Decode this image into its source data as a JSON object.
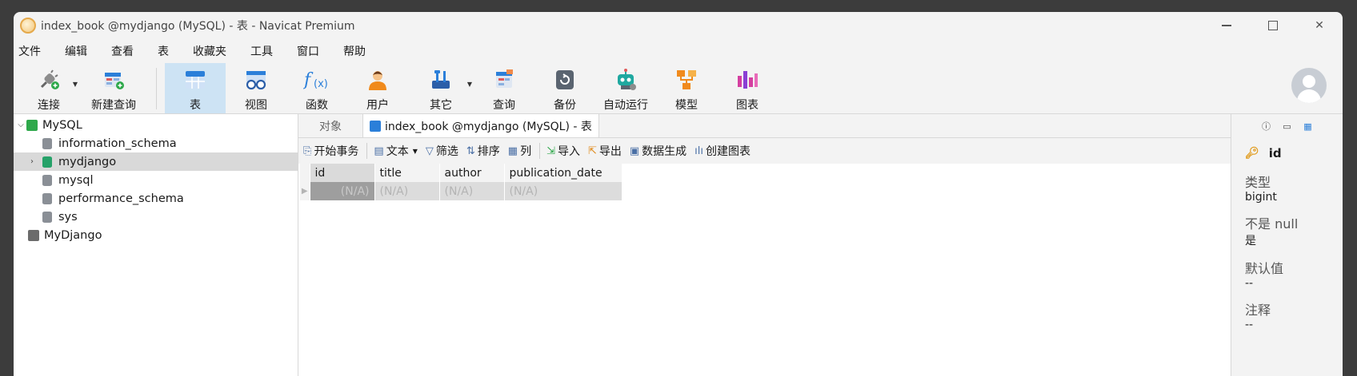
{
  "window": {
    "title": "index_book @mydjango (MySQL) - 表 - Navicat Premium"
  },
  "menu": [
    "文件",
    "编辑",
    "查看",
    "表",
    "收藏夹",
    "工具",
    "窗口",
    "帮助"
  ],
  "toolbar": {
    "connect": "连接",
    "new_query": "新建查询",
    "table": "表",
    "view": "视图",
    "function": "函数",
    "user": "用户",
    "other": "其它",
    "query": "查询",
    "backup": "备份",
    "automation": "自动运行",
    "model": "模型",
    "chart": "图表"
  },
  "nav": {
    "connection": "MySQL",
    "databases": [
      "information_schema",
      "mydjango",
      "mysql",
      "performance_schema",
      "sys"
    ],
    "connection2": "MyDjango"
  },
  "tabs": {
    "objects": "对象",
    "active": "index_book @mydjango (MySQL) - 表"
  },
  "subtoolbar": {
    "begin_transaction": "开始事务",
    "text": "文本",
    "filter": "筛选",
    "sort": "排序",
    "columns": "列",
    "import": "导入",
    "export": "导出",
    "data_generation": "数据生成",
    "create_chart": "创建图表"
  },
  "grid": {
    "columns": [
      "id",
      "title",
      "author",
      "publication_date"
    ],
    "row": [
      "(N/A)",
      "(N/A)",
      "(N/A)",
      "(N/A)"
    ]
  },
  "side": {
    "field": "id",
    "type_label": "类型",
    "type_value": "bigint",
    "notnull_label": "不是 null",
    "notnull_value": "是",
    "default_label": "默认值",
    "default_value": "--",
    "comment_label": "注释",
    "comment_value": "--"
  },
  "colors": {
    "accent": "#2b7fd9",
    "active_tool": "#cde3f4",
    "key": "#e09a1a"
  }
}
